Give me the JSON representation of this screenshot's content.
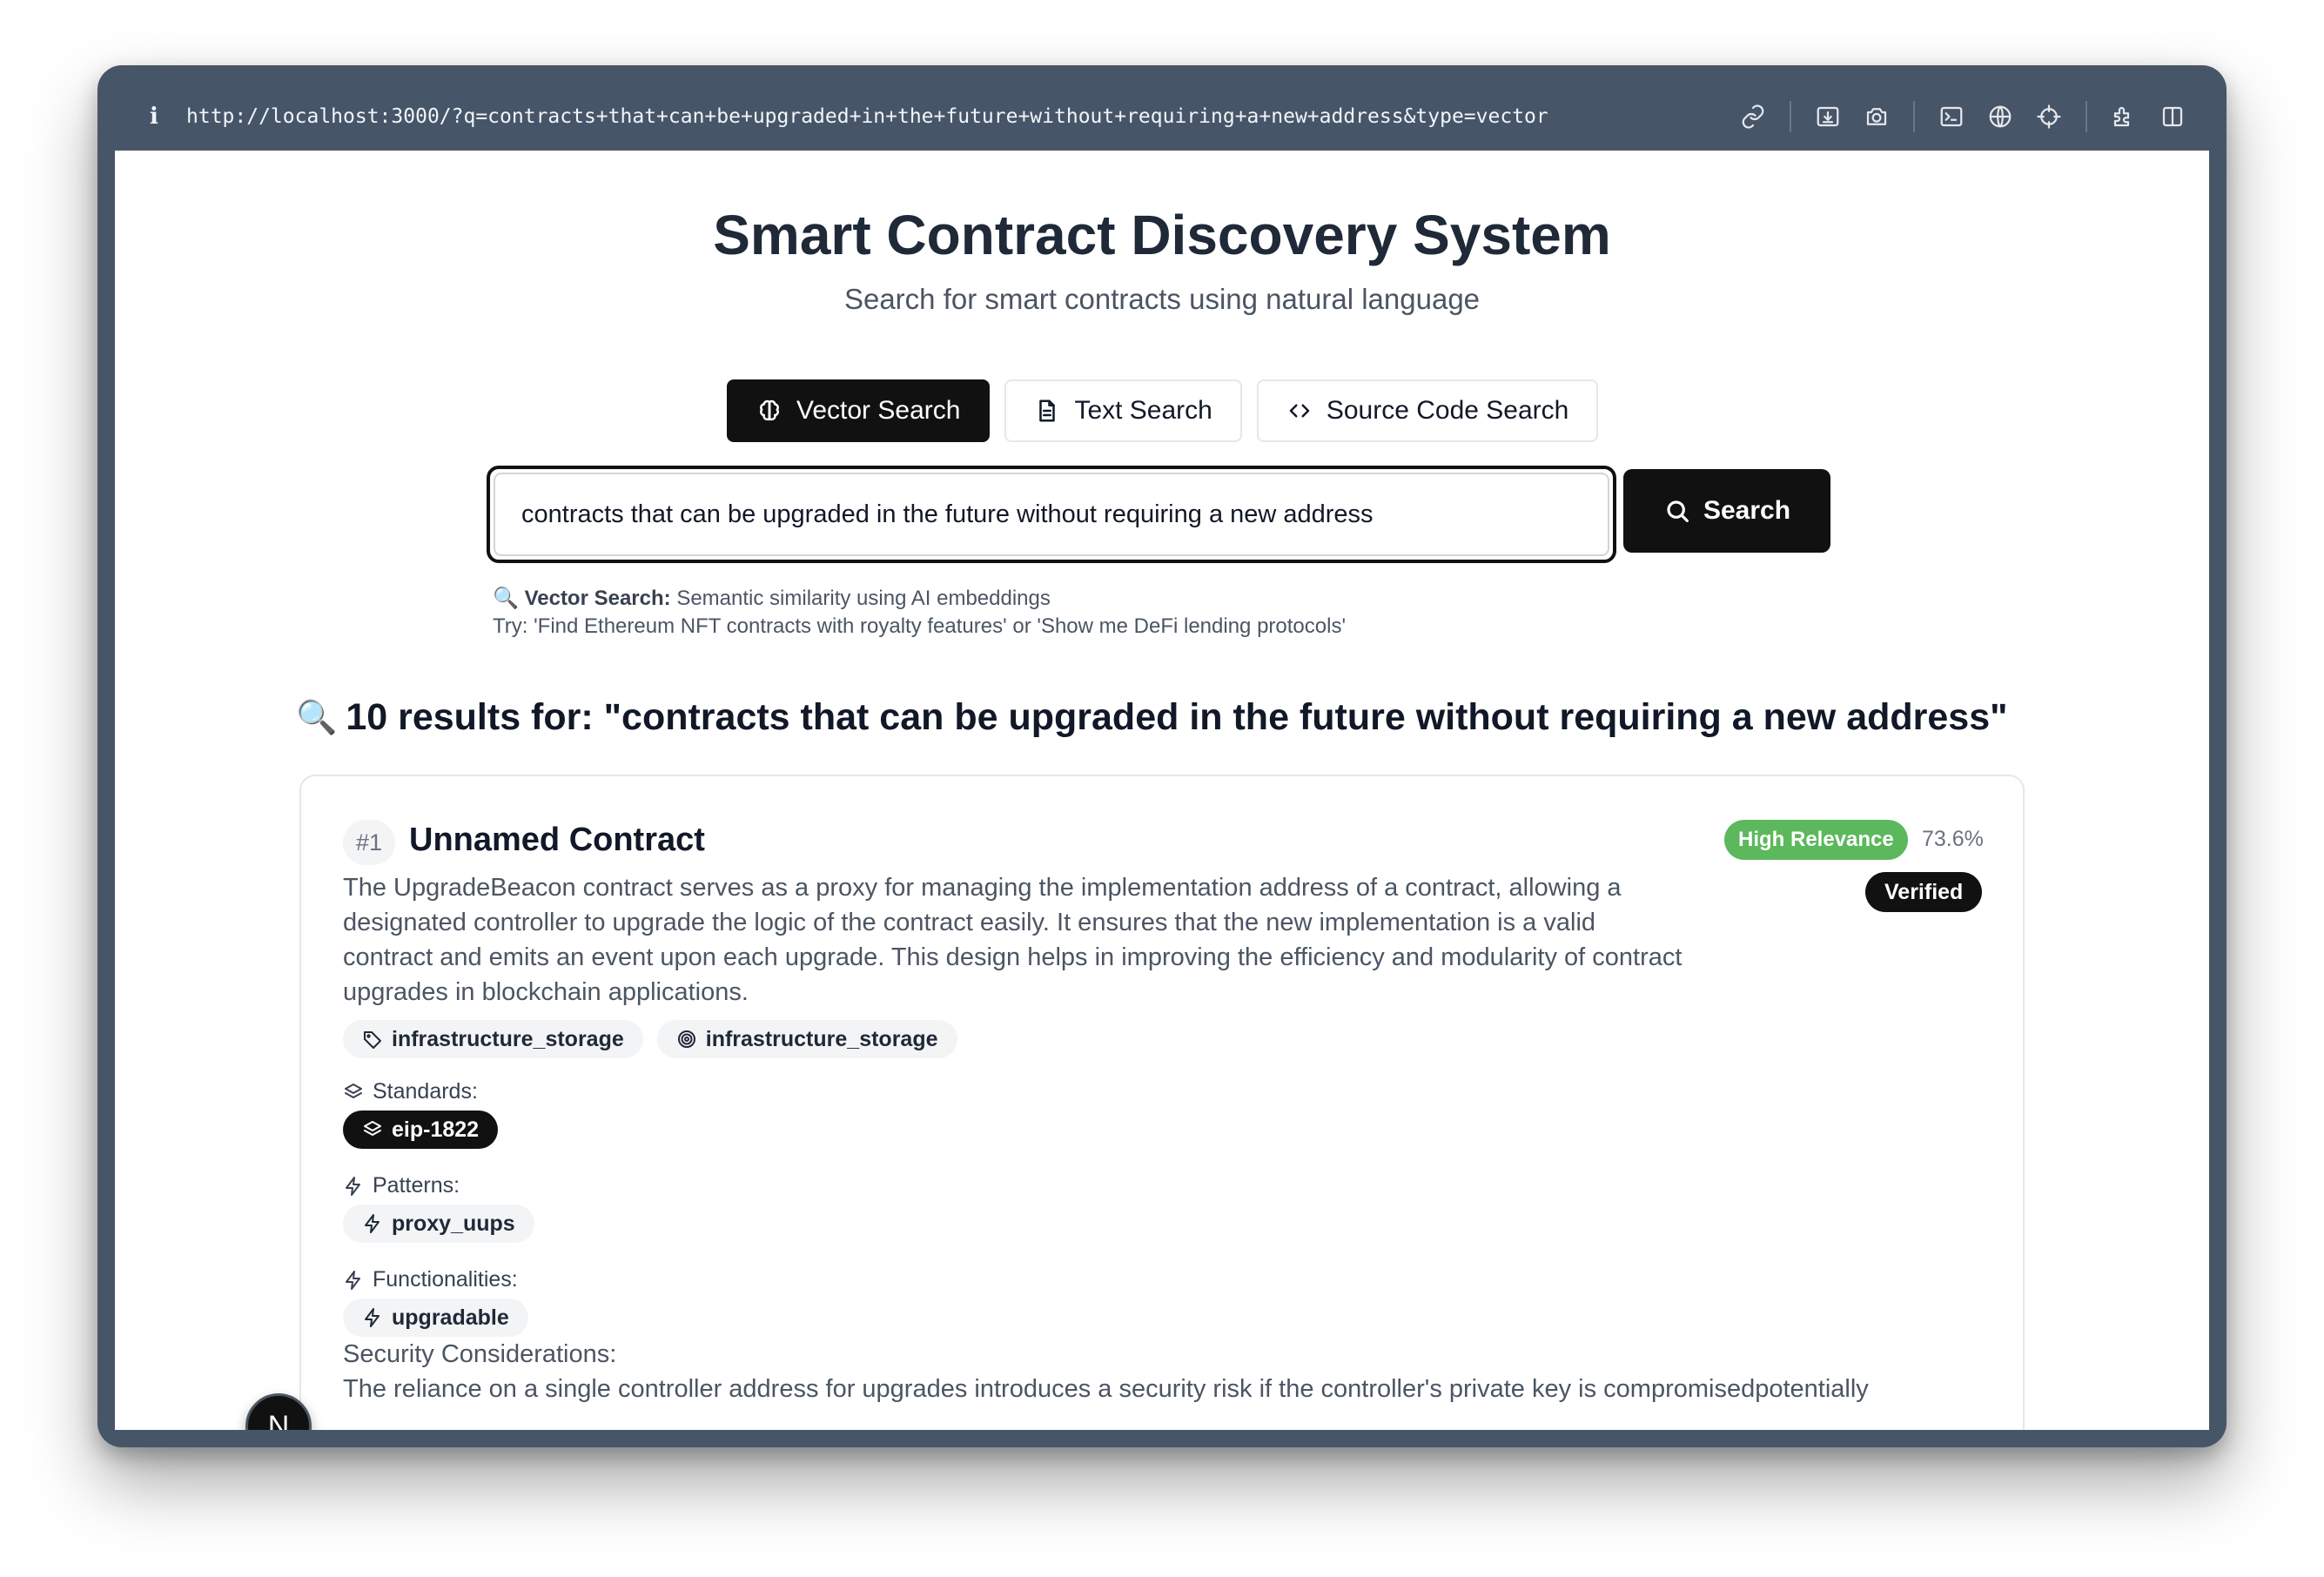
{
  "browser": {
    "url": "http://localhost:3000/?q=contracts+that+can+be+upgraded+in+the+future+without+requiring+a+new+address&type=vector",
    "info_glyph": "i",
    "toolbar_icons": [
      "link-icon",
      "screenshot-icon",
      "camera-icon",
      "terminal-icon",
      "globe-icon",
      "crosshair-icon",
      "extensions-icon",
      "sidebar-icon"
    ]
  },
  "header": {
    "title": "Smart Contract Discovery System",
    "subtitle": "Search for smart contracts using natural language"
  },
  "search_modes": [
    {
      "label": "Vector Search",
      "icon": "brain-icon",
      "active": true
    },
    {
      "label": "Text Search",
      "icon": "document-icon",
      "active": false
    },
    {
      "label": "Source Code Search",
      "icon": "code-icon",
      "active": false
    }
  ],
  "search": {
    "query": "contracts that can be upgraded in the future without requiring a new address",
    "button_label": "Search",
    "hint_mode": "Vector Search:",
    "hint_mode_desc": "Semantic similarity using AI embeddings",
    "hint_examples": "Try: 'Find Ethereum NFT contracts with royalty features' or 'Show me DeFi lending protocols'"
  },
  "results": {
    "heading": "10 results for: \"contracts that can be upgraded in the future without requiring a new address\"",
    "items": [
      {
        "rank": "#1",
        "name": "Unnamed Contract",
        "description": "The UpgradeBeacon contract serves as a proxy for managing the implementation address of a contract, allowing a designated controller to upgrade the logic of the contract easily. It ensures that the new implementation is a valid contract and emits an event upon each upgrade. This design helps in improving the efficiency and modularity of contract upgrades in blockchain applications.",
        "relevance_label": "High Relevance",
        "relevance_score": "73.6%",
        "verified_label": "Verified",
        "category_tag": "infrastructure_storage",
        "domain_tag": "infrastructure_storage",
        "standards_label": "Standards:",
        "standards": [
          "eip-1822"
        ],
        "patterns_label": "Patterns:",
        "patterns": [
          "proxy_uups"
        ],
        "functionalities_label": "Functionalities:",
        "functionalities": [
          "upgradable"
        ],
        "security_label": "Security Considerations:",
        "security_text": "The reliance on a single controller address for upgrades introduces a security risk if the controller's private key is compromisedpotentially"
      }
    ]
  },
  "dev_badge": "N",
  "colors": {
    "accent": "#111111",
    "relevance_high": "#5cb85c",
    "window_chrome": "#475569"
  }
}
